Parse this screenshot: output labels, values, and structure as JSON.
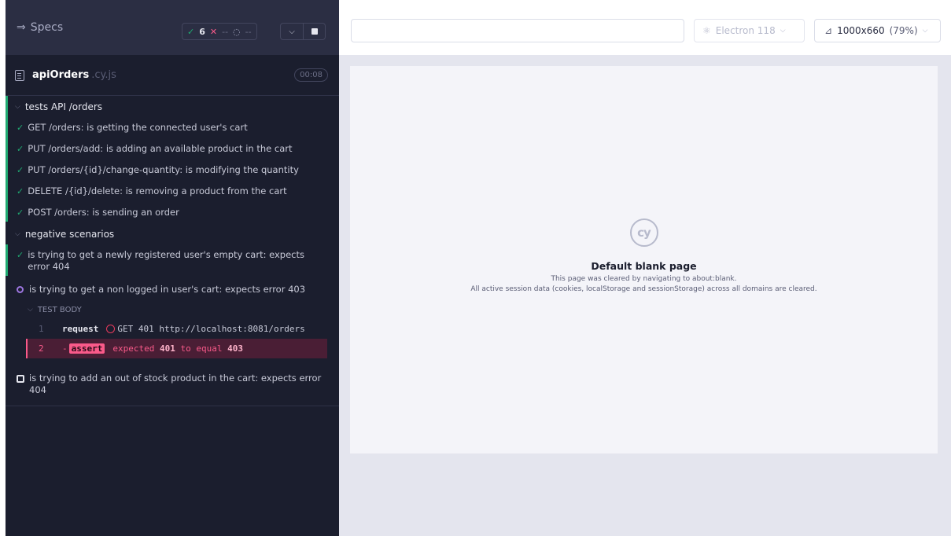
{
  "header": {
    "specs_label": "Specs",
    "stats": {
      "passed": "6",
      "failed": "--",
      "pending": "--"
    }
  },
  "spec_file": {
    "name": "apiOrders",
    "ext": ".cy.js",
    "duration": "00:08"
  },
  "suites": [
    {
      "title": "tests API /orders",
      "tests": [
        "GET /orders: is getting the connected user's cart",
        "PUT /orders/add: is adding an available product in the cart",
        "PUT /orders/{id}/change-quantity: is modifying the quantity",
        "DELETE /{id}/delete: is removing a product from the cart",
        "POST /orders: is sending an order"
      ]
    },
    {
      "title": "negative scenarios",
      "passed_test": "is trying to get a newly registered user's empty cart: expects error 404",
      "running_test": "is trying to get a non logged in user's cart: expects error 403",
      "test_body_label": "TEST BODY",
      "commands": [
        {
          "num": "1",
          "name": "request",
          "message": "GET 401 http://localhost:8081/orders"
        },
        {
          "num": "2",
          "name": "assert",
          "prefix": "-",
          "pre": "expected",
          "a": "401",
          "mid": "to equal",
          "b": "403"
        }
      ],
      "stopped_test": "is trying to add an out of stock product in the cart: expects error 404"
    }
  ],
  "toolbar": {
    "url_value": "",
    "browser": "Electron 118",
    "viewport_dims": "1000x660",
    "viewport_pct": "(79%)"
  },
  "blank_page": {
    "logo_text": "cy",
    "title": "Default blank page",
    "line1": "This page was cleared by navigating to about:blank.",
    "line2": "All active session data (cookies, localStorage and sessionStorage) across all domains are cleared."
  }
}
